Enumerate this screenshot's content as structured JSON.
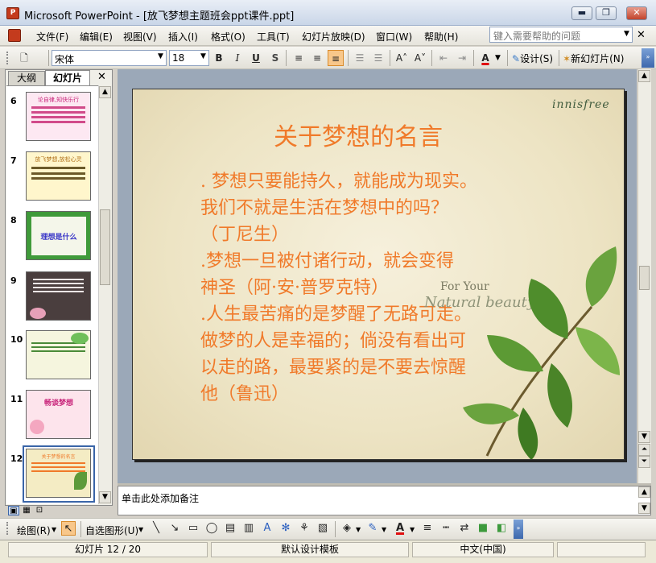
{
  "window": {
    "app_title": "Microsoft PowerPoint - [放飞梦想主题班会ppt课件.ppt]",
    "minimize_label": "▬",
    "restore_label": "❐",
    "close_label": "✕"
  },
  "menu": {
    "items": [
      "文件(F)",
      "编辑(E)",
      "视图(V)",
      "插入(I)",
      "格式(O)",
      "工具(T)",
      "幻灯片放映(D)",
      "窗口(W)",
      "帮助(H)"
    ],
    "help_placeholder": "键入需要帮助的问题",
    "close_label": "✕"
  },
  "toolbar": {
    "font_name": "宋体",
    "font_size": "18",
    "bold": "B",
    "italic": "I",
    "underline": "U",
    "shadow": "S",
    "font_color": "A",
    "design_label": "设计(S)",
    "new_slide_label": "新幻灯片(N)"
  },
  "panes": {
    "tab_outline": "大纲",
    "tab_slides": "幻灯片",
    "close_label": "✕"
  },
  "thumbnails": [
    {
      "number": "6",
      "label": "论自律,知快乐行",
      "bg": "#fde8f2",
      "accent": "#c8247a"
    },
    {
      "number": "7",
      "label": "放飞梦想,放松心灵",
      "bg": "#fff6cc",
      "accent": "#b0701a"
    },
    {
      "number": "8",
      "label": "理想是什么",
      "bg": "#3f9a3a",
      "accent": "#3a37c8"
    },
    {
      "number": "9",
      "label": "",
      "bg": "#4a3e3e",
      "accent": "#e7a0b8"
    },
    {
      "number": "10",
      "label": "",
      "bg": "#f5f5de",
      "accent": "#4a8a38"
    },
    {
      "number": "11",
      "label": "畅谈梦想",
      "bg": "#fde4ec",
      "accent": "#c8247a"
    },
    {
      "number": "12",
      "label": "关于梦想的名言",
      "bg": "#f4ecc4",
      "accent": "#f07a2a"
    }
  ],
  "slide": {
    "brand": "innisfree",
    "title": "关于梦想的名言",
    "body_lines": [
      ". 梦想只要能持久，就能成为现实。",
      "我们不就是生活在梦想中的吗？",
      "（丁尼生）",
      ".梦想一旦被付诸行动，就会变得",
      "神圣（阿·安·普罗克特）",
      ".人生最苦痛的是梦醒了无路可走。",
      "做梦的人是幸福的；倘没有看出可",
      "以走的路，最要紧的是不要去惊醒",
      "他（鲁迅）"
    ],
    "for_your": "For Your",
    "natural_beauty": "Natural beauty",
    "title_color": "#f07a2a"
  },
  "notes": {
    "placeholder": "单击此处添加备注"
  },
  "drawbar": {
    "draw_label": "绘图(R)",
    "autoshapes_label": "自选图形(U)"
  },
  "status": {
    "slide_position": "幻灯片 12 / 20",
    "template": "默认设计模板",
    "language": "中文(中国)"
  }
}
